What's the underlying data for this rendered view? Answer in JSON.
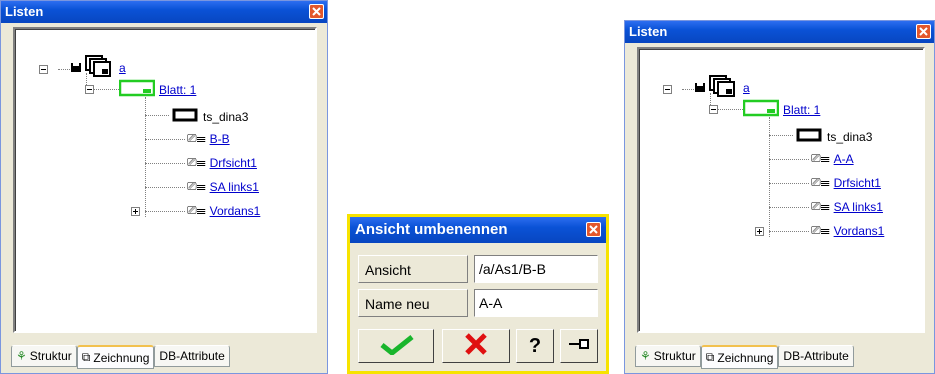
{
  "left_panel": {
    "title": "Listen",
    "tree": {
      "root": "a",
      "sheet": "Blatt: 1",
      "frame": "ts_dina3",
      "views": [
        "B-B",
        "Drfsicht1",
        "SA links1",
        "Vordans1"
      ]
    },
    "tabs": [
      "Struktur",
      "Zeichnung",
      "DB-Attribute"
    ]
  },
  "right_panel": {
    "title": "Listen",
    "tree": {
      "root": "a",
      "sheet": "Blatt: 1",
      "frame": "ts_dina3",
      "views": [
        "A-A",
        "Drfsicht1",
        "SA links1",
        "Vordans1"
      ]
    },
    "tabs": [
      "Struktur",
      "Zeichnung",
      "DB-Attribute"
    ]
  },
  "dialog": {
    "title": "Ansicht umbenennen",
    "view_label": "Ansicht",
    "view_value": "/a/As1/B-B",
    "new_name_label": "Name neu",
    "new_name_value": "A-A"
  },
  "colors": {
    "titlebar": "#0a52d6",
    "link": "#0000cc",
    "sheet_icon": "#22cc22",
    "close": "#e3572b",
    "ok": "#19b52c",
    "cancel": "#e01010"
  }
}
